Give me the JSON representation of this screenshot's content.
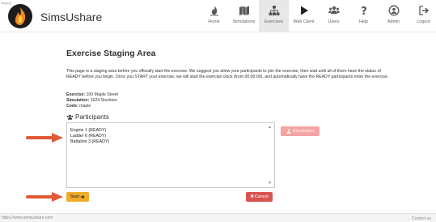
{
  "header": {
    "stage_tag": "staging",
    "brand": "SimsUshare",
    "nav": [
      {
        "label": "Home",
        "icon": "fire-icon"
      },
      {
        "label": "Simulations",
        "icon": "map-icon"
      },
      {
        "label": "Exercises",
        "icon": "sitemap-icon"
      },
      {
        "label": "Web Client",
        "icon": "play-icon"
      },
      {
        "label": "Users",
        "icon": "users-icon"
      },
      {
        "label": "Help",
        "icon": "question-icon"
      },
      {
        "label": "Admin",
        "icon": "user-circle-icon"
      },
      {
        "label": "Logout",
        "icon": "logout-icon"
      }
    ],
    "active_nav": "Exercises"
  },
  "main": {
    "title": "Exercise Staging Area",
    "intro": "This page is a staging area before you officially start the exercise. We suggest you allow your participants to join the exercise, then wait until all of them have the status of READY before you begin. Once you START your exercise, we will start the exercise clock (from 00:00:00), and automatically have the READY participants enter the exercise.",
    "exercise_label": "Exercise:",
    "exercise_value": "100 Maple Street",
    "simulation_label": "Simulation:",
    "simulation_value": "1624 Stockton",
    "code_label": "Code:",
    "code_value": "maple",
    "participants_heading": "Participants",
    "participants": [
      "Engine 1 (READY)",
      "Ladder 6 (READY)",
      "Battalion 3 (READY)"
    ],
    "disconnect_label": "Disconnect",
    "start_label": "Start",
    "cancel_label": "Cancel"
  },
  "footer": {
    "left": "https://www.simsushare.com",
    "right": "Contact us"
  },
  "colors": {
    "start": "#f0ad2a",
    "cancel": "#d9534f",
    "disconnect": "#f3a4a4",
    "arrow": "#e05a36"
  }
}
